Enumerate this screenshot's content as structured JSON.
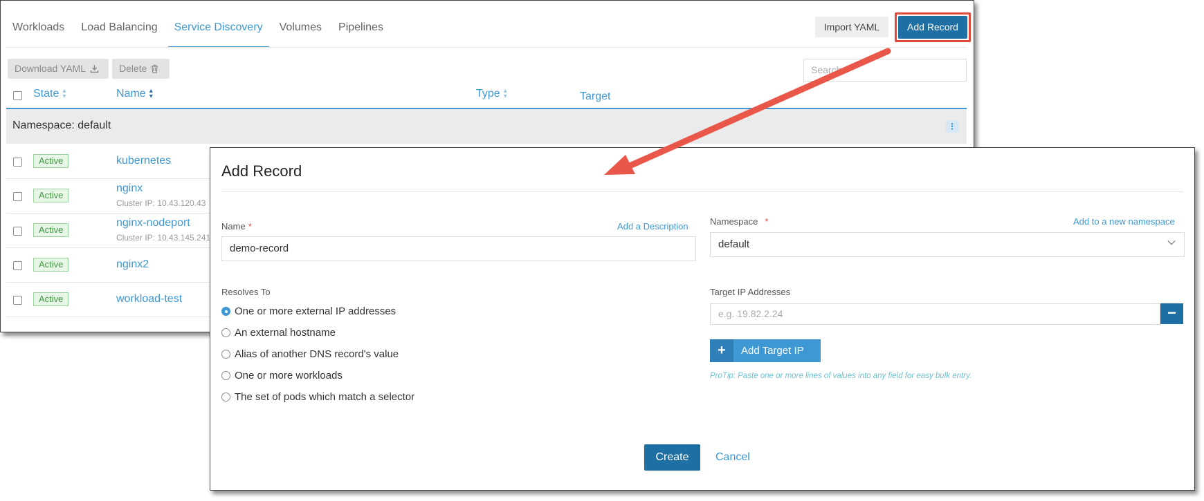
{
  "tabs": [
    "Workloads",
    "Load Balancing",
    "Service Discovery",
    "Volumes",
    "Pipelines"
  ],
  "active_tab": "Service Discovery",
  "header_buttons": {
    "import_yaml": "Import YAML",
    "add_record": "Add Record"
  },
  "toolbar": {
    "download_yaml": "Download YAML",
    "delete": "Delete",
    "search_placeholder": "Search"
  },
  "table": {
    "columns": [
      "State",
      "Name",
      "Type",
      "Target"
    ],
    "namespace_group": "Namespace: default",
    "rows": [
      {
        "state": "Active",
        "name": "kubernetes",
        "sub": ""
      },
      {
        "state": "Active",
        "name": "nginx",
        "sub": "Cluster IP: 10.43.120.43"
      },
      {
        "state": "Active",
        "name": "nginx-nodeport",
        "sub": "Cluster IP: 10.43.145.241"
      },
      {
        "state": "Active",
        "name": "nginx2",
        "sub": ""
      },
      {
        "state": "Active",
        "name": "workload-test",
        "sub": ""
      }
    ]
  },
  "modal": {
    "title": "Add Record",
    "name_label": "Name",
    "add_description_link": "Add a Description",
    "name_value": "demo-record",
    "namespace_label": "Namespace",
    "add_namespace_link": "Add to a new namespace",
    "namespace_value": "default",
    "resolves_to_label": "Resolves To",
    "resolves_options": [
      {
        "label": "One or more external IP addresses",
        "checked": true
      },
      {
        "label": "An external hostname",
        "checked": false
      },
      {
        "label": "Alias of another DNS record's value",
        "checked": false
      },
      {
        "label": "One or more workloads",
        "checked": false
      },
      {
        "label": "The set of pods which match a selector",
        "checked": false
      }
    ],
    "target_ip_label": "Target IP Addresses",
    "target_ip_placeholder": "e.g. 19.82.2.24",
    "add_target_ip": "Add Target IP",
    "protip": "ProTip: Paste one or more lines of values into any field for easy bulk entry.",
    "create": "Create",
    "cancel": "Cancel"
  },
  "colors": {
    "accent": "#3d98d3",
    "primary_button": "#1d6fa4",
    "highlight_frame": "#e0493c",
    "arrow": "#e9574a",
    "active_badge": "#3f9a3f"
  }
}
